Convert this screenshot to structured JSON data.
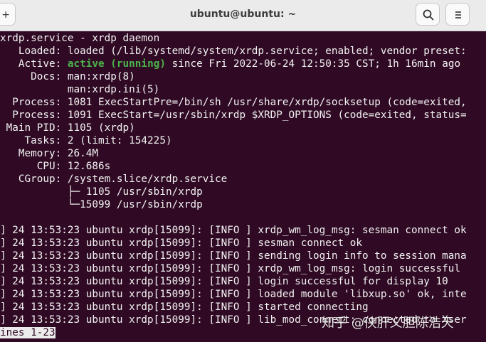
{
  "window": {
    "title": "ubuntu@ubuntu: ~",
    "newtab_glyph": "+"
  },
  "icons": {
    "search": "search-icon",
    "menu": "hamburger-menu-icon",
    "newtab": "plus-icon"
  },
  "colors": {
    "terminal_bg": "#300a24",
    "text": "#f2f2f2",
    "active_status": "#4cb34c"
  },
  "status": {
    "header": "xrdp.service - xrdp daemon",
    "loaded": "   Loaded: loaded (/lib/systemd/system/xrdp.service; enabled; vendor preset:",
    "active_label": "   Active: ",
    "active_value": "active (running)",
    "active_rest": " since Fri 2022-06-24 12:50:35 CST; 1h 16min ago",
    "docs1": "     Docs: man:xrdp(8)",
    "docs2": "           man:xrdp.ini(5)",
    "process1": "  Process: 1081 ExecStartPre=/bin/sh /usr/share/xrdp/socksetup (code=exited,",
    "process2": "  Process: 1091 ExecStart=/usr/sbin/xrdp $XRDP_OPTIONS (code=exited, status=",
    "mainpid": " Main PID: 1105 (xrdp)",
    "tasks": "    Tasks: 2 (limit: 154225)",
    "memory": "   Memory: 26.4M",
    "cpu": "      CPU: 12.686s",
    "cgroup": "   CGroup: /system.slice/xrdp.service",
    "tree1": "           ├─ 1105 /usr/sbin/xrdp",
    "tree2": "           └─15099 /usr/sbin/xrdp"
  },
  "log": [
    "] 24 13:53:23 ubuntu xrdp[15099]: [INFO ] xrdp_wm_log_msg: sesman connect ok",
    "] 24 13:53:23 ubuntu xrdp[15099]: [INFO ] sesman connect ok",
    "] 24 13:53:23 ubuntu xrdp[15099]: [INFO ] sending login info to session mana",
    "] 24 13:53:23 ubuntu xrdp[15099]: [INFO ] xrdp_wm_log_msg: login successful",
    "] 24 13:53:23 ubuntu xrdp[15099]: [INFO ] login successful for display 10",
    "] 24 13:53:23 ubuntu xrdp[15099]: [INFO ] loaded module 'libxup.so' ok, inte",
    "] 24 13:53:23 ubuntu xrdp[15099]: [INFO ] started connecting",
    "] 24 13:53:23 ubuntu xrdp[15099]: [INFO ] lib_mod_connect: connected to Xser"
  ],
  "pager": "ines 1-23",
  "watermark": "知乎 @侠肝义胆陈浩天"
}
